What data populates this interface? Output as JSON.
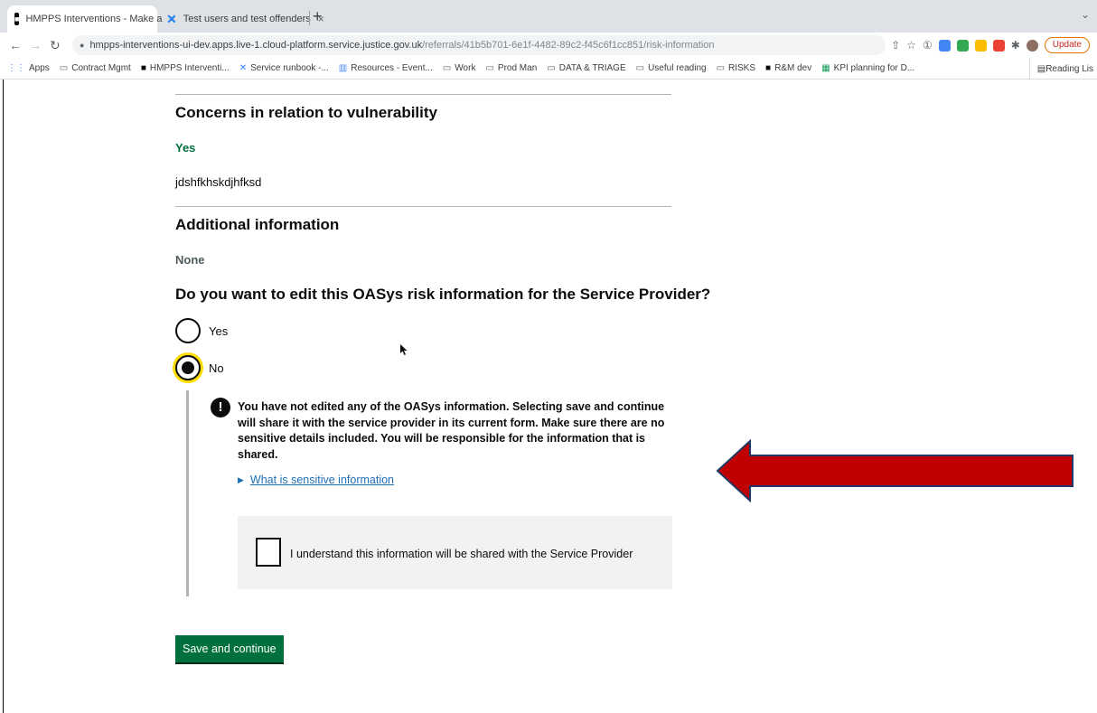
{
  "browser": {
    "tabs": [
      {
        "title": "HMPPS Interventions - Make a",
        "favicon": "hmpps-logo-icon",
        "active": true
      },
      {
        "title": "Test users and test offenders",
        "favicon": "confluence-icon",
        "active": false
      }
    ],
    "new_tab_symbol": "+",
    "url_host": "hmpps-interventions-ui-dev.apps.live-1.cloud-platform.service.justice.gov.uk",
    "url_path": "/referrals/41b5b701-6e1f-4482-89c2-f45c6f1cc851/risk-information",
    "update_label": "Update",
    "bookmarks": [
      {
        "label": "Apps",
        "icon": "apps-grid-icon"
      },
      {
        "label": "Contract Mgmt",
        "icon": "folder-icon"
      },
      {
        "label": "HMPPS Interventi...",
        "icon": "hmpps-logo-icon"
      },
      {
        "label": "Service runbook -...",
        "icon": "confluence-icon"
      },
      {
        "label": "Resources - Event...",
        "icon": "bar-chart-icon"
      },
      {
        "label": "Work",
        "icon": "folder-icon"
      },
      {
        "label": "Prod Man",
        "icon": "folder-icon"
      },
      {
        "label": "DATA & TRIAGE",
        "icon": "folder-icon"
      },
      {
        "label": "Useful reading",
        "icon": "folder-icon"
      },
      {
        "label": "RISKS",
        "icon": "folder-icon"
      },
      {
        "label": "R&M dev",
        "icon": "hmpps-logo-icon"
      },
      {
        "label": "KPI planning for D...",
        "icon": "sheets-icon"
      }
    ],
    "reading_list_label": "Reading Lis"
  },
  "page": {
    "vulnerability": {
      "heading": "Concerns in relation to vulnerability",
      "answer": "Yes",
      "details": "jdshfkhskdjhfksd"
    },
    "additional": {
      "heading": "Additional information",
      "answer": "None"
    },
    "edit_question": {
      "legend": "Do you want to edit this OASys risk information for the Service Provider?",
      "options": [
        {
          "label": "Yes",
          "checked": false
        },
        {
          "label": "No",
          "checked": true
        }
      ]
    },
    "warning": {
      "icon_symbol": "!",
      "text": "You have not edited any of the OASys information. Selecting save and continue will share it with the service provider in its current form. Make sure there are no sensitive details included. You will be responsible for the information that is shared."
    },
    "details_link": "What is sensitive information",
    "confirm_checkbox_label": "I understand this information will be shared with the Service Provider",
    "save_button": "Save and continue"
  },
  "colors": {
    "govuk_green": "#00703c",
    "govuk_link_blue": "#1d70b8",
    "focus_yellow": "#ffdd00",
    "annotation_arrow": "#c00000"
  }
}
